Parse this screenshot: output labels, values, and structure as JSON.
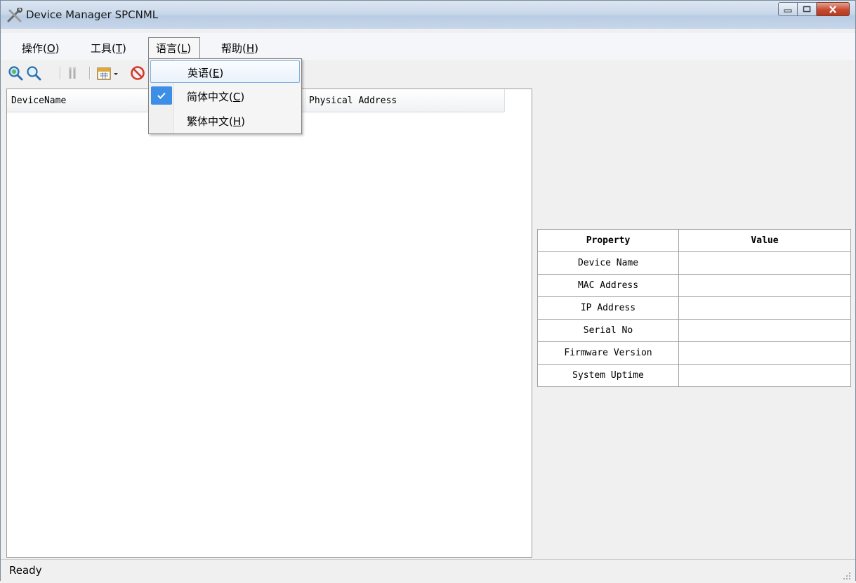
{
  "window": {
    "title": "Device Manager SPCNML",
    "icon": "tools-icon",
    "controls": [
      "minimize-icon",
      "maximize-icon",
      "close-icon"
    ]
  },
  "menu": {
    "items": [
      {
        "label": "操作(O)",
        "base": "操作(",
        "accel": "O",
        "tail": ")"
      },
      {
        "label": "工具(T)",
        "base": "工具(",
        "accel": "T",
        "tail": ")"
      },
      {
        "label": "语言(L)",
        "base": "语言(",
        "accel": "L",
        "tail": ")"
      },
      {
        "label": "帮助(H)",
        "base": "帮助(",
        "accel": "H",
        "tail": ")"
      }
    ]
  },
  "language_menu": {
    "items": [
      {
        "base": "英语(",
        "accel": "E",
        "tail": ")",
        "checked": false,
        "highlighted": true
      },
      {
        "base": "简体中文(",
        "accel": "C",
        "tail": ")",
        "checked": true,
        "highlighted": false
      },
      {
        "base": "繁体中文(",
        "accel": "H",
        "tail": ")",
        "checked": false,
        "highlighted": false
      }
    ]
  },
  "toolbar": {
    "icons": [
      "search-network-icon",
      "search-icon",
      "tools-icon",
      "calendar-dropdown-icon",
      "stop-icon"
    ]
  },
  "device_list": {
    "columns": [
      "DeviceName",
      "Physical Address"
    ]
  },
  "properties": {
    "header": {
      "property": "Property",
      "value": "Value"
    },
    "rows": [
      {
        "property": "Device Name",
        "value": ""
      },
      {
        "property": "MAC Address",
        "value": ""
      },
      {
        "property": "IP Address",
        "value": ""
      },
      {
        "property": "Serial No",
        "value": ""
      },
      {
        "property": "Firmware Version",
        "value": ""
      },
      {
        "property": "System Uptime",
        "value": ""
      }
    ]
  },
  "status": {
    "text": "Ready"
  },
  "colors": {
    "accent": "#3d8ee6",
    "highlight_border": "#7fb1e0",
    "close_button": "#c8492f"
  }
}
